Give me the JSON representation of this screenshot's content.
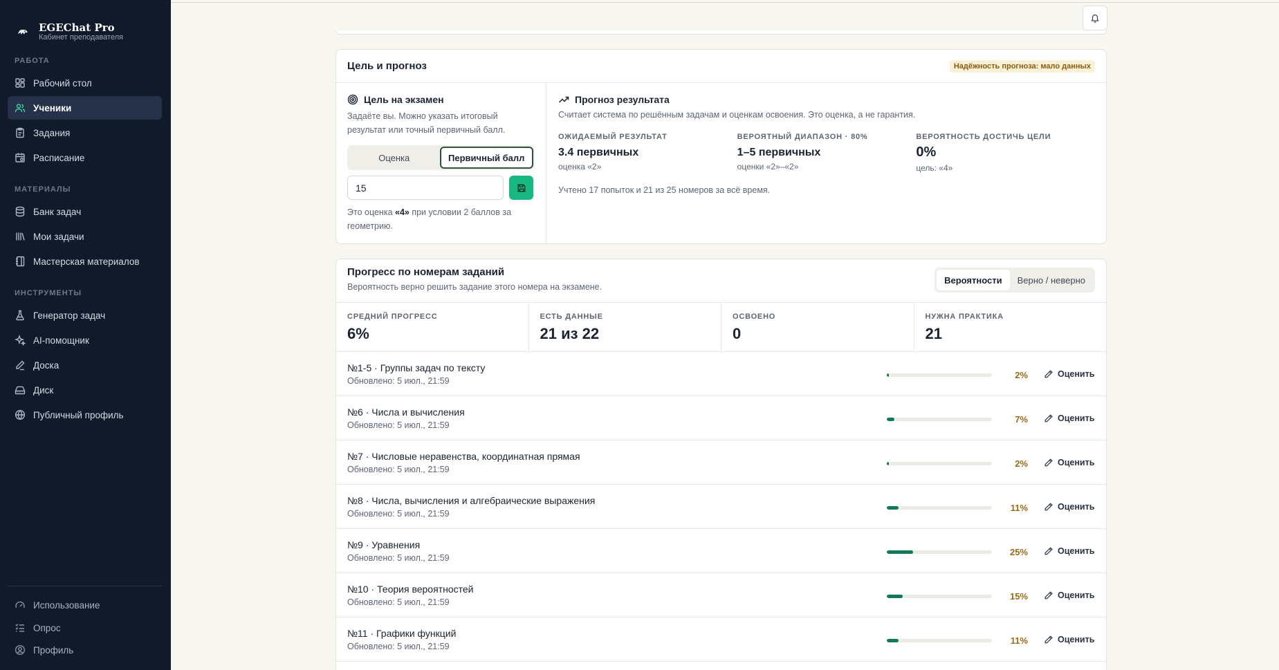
{
  "brand": {
    "name": "EGEChat Pro",
    "subtitle": "Кабинет преподавателя"
  },
  "sidebar": {
    "sections": [
      "РАБОТА",
      "МАТЕРИАЛЫ",
      "ИНСТРУМЕНТЫ"
    ],
    "work": [
      {
        "label": "Рабочий стол",
        "icon": "dashboard-icon"
      },
      {
        "label": "Ученики",
        "icon": "users-icon",
        "active": true
      },
      {
        "label": "Задания",
        "icon": "clipboard-icon"
      },
      {
        "label": "Расписание",
        "icon": "calendar-icon"
      }
    ],
    "materials": [
      {
        "label": "Банк задач",
        "icon": "database-icon"
      },
      {
        "label": "Мои задачи",
        "icon": "library-icon"
      },
      {
        "label": "Мастерская материалов",
        "icon": "notebook-icon"
      }
    ],
    "tools": [
      {
        "label": "Генератор задач",
        "icon": "flask-icon"
      },
      {
        "label": "AI-помощник",
        "icon": "sparkles-icon"
      },
      {
        "label": "Доска",
        "icon": "pen-icon"
      },
      {
        "label": "Диск",
        "icon": "hard-drive-icon"
      },
      {
        "label": "Публичный профиль",
        "icon": "globe-icon"
      }
    ],
    "bottom": [
      {
        "label": "Использование",
        "icon": "gauge-icon"
      },
      {
        "label": "Опрос",
        "icon": "list-checks-icon"
      },
      {
        "label": "Профиль",
        "icon": "user-circle-icon"
      }
    ]
  },
  "goal": {
    "title": "Цель и прогноз",
    "badge": "Надёжность прогноза: мало данных",
    "exam": {
      "title": "Цель на экзамен",
      "desc": "Задаёте вы. Можно указать итоговый результат или точный первичный балл.",
      "mode_grade": "Оценка",
      "mode_primary": "Первичный балл",
      "value": "15",
      "note_pre": "Это оценка ",
      "note_grade": "«4»",
      "note_post": " при условии 2 баллов за геометрию."
    },
    "forecast": {
      "title": "Прогноз результата",
      "desc": "Считает система по решённым задачам и оценкам освоения. Это оценка, а не гарантия.",
      "expected_label": "ОЖИДАЕМЫЙ РЕЗУЛЬТАТ",
      "expected_value": "3.4 первичных",
      "expected_sub": "оценка «2»",
      "range_label": "ВЕРОЯТНЫЙ ДИАПАЗОН · 80%",
      "range_value": "1–5 первичных",
      "range_sub": "оценки «2»–«2»",
      "chance_label": "ВЕРОЯТНОСТЬ ДОСТИЧЬ ЦЕЛИ",
      "chance_value": "0%",
      "chance_sub": "цель: «4»",
      "footer": "Учтено 17 попыток и 21 из 25 номеров за всё время."
    }
  },
  "progress": {
    "title": "Прогресс по номерам заданий",
    "subtitle": "Вероятность верно решить задание этого номера на экзамене.",
    "toggle": [
      "Вероятности",
      "Верно / неверно"
    ],
    "stats": [
      {
        "label": "СРЕДНИЙ ПРОГРЕСС",
        "value": "6%"
      },
      {
        "label": "ЕСТЬ ДАННЫЕ",
        "value": "21 из 22"
      },
      {
        "label": "ОСВОЕНО",
        "value": "0"
      },
      {
        "label": "НУЖНА ПРАКТИКА",
        "value": "21"
      }
    ],
    "rate_label": "Оценить",
    "rows": [
      {
        "title": "№1-5 · Группы задач по тексту",
        "updated": "Обновлено: 5 июл., 21:59",
        "pct_text": "2%",
        "pct": 2
      },
      {
        "title": "№6 · Числа и вычисления",
        "updated": "Обновлено: 5 июл., 21:59",
        "pct_text": "7%",
        "pct": 7
      },
      {
        "title": "№7 · Числовые неравенства, координатная прямая",
        "updated": "Обновлено: 5 июл., 21:59",
        "pct_text": "2%",
        "pct": 2
      },
      {
        "title": "№8 · Числа, вычисления и алгебраические выражения",
        "updated": "Обновлено: 5 июл., 21:59",
        "pct_text": "11%",
        "pct": 11
      },
      {
        "title": "№9 · Уравнения",
        "updated": "Обновлено: 5 июл., 21:59",
        "pct_text": "25%",
        "pct": 25
      },
      {
        "title": "№10 · Теория вероятностей",
        "updated": "Обновлено: 5 июл., 21:59",
        "pct_text": "15%",
        "pct": 15
      },
      {
        "title": "№11 · Графики функций",
        "updated": "Обновлено: 5 июл., 21:59",
        "pct_text": "11%",
        "pct": 11
      }
    ]
  },
  "colors": {
    "sidebar_bg": "#111a2b",
    "accent": "#0f7a55",
    "save_button": "#19b883",
    "percent": "#9a6a17",
    "badge_bg": "#fbf1d9"
  }
}
